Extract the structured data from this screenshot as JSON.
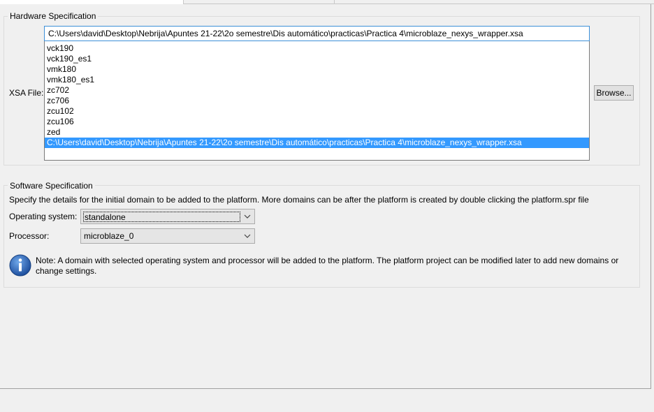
{
  "hardware": {
    "group_title": "Hardware Specification",
    "xsa_label": "XSA File:",
    "xsa_value": "C:\\Users\\david\\Desktop\\Nebrija\\Apuntes 21-22\\2o semestre\\Dis automático\\practicas\\Practica 4\\microblaze_nexys_wrapper.xsa",
    "browse_label": "Browse...",
    "options": [
      "vck190",
      "vck190_es1",
      "vmk180",
      "vmk180_es1",
      "zc702",
      "zc706",
      "zcu102",
      "zcu106",
      "zed",
      "C:\\Users\\david\\Desktop\\Nebrija\\Apuntes 21-22\\2o semestre\\Dis automático\\practicas\\Practica 4\\microblaze_nexys_wrapper.xsa"
    ],
    "selected_index": 9
  },
  "software": {
    "group_title": "Software Specification",
    "description": "Specify the details for the initial domain to be added to the platform. More domains can be after the platform is created by double clicking the platform.spr file",
    "os_label": "Operating system:",
    "os_value": "standalone",
    "processor_label": "Processor:",
    "processor_value": "microblaze_0",
    "note": "Note: A domain with selected operating system and processor will be added to the platform. The platform project can be modified later to add new domains or change settings."
  },
  "colors": {
    "selection": "#3399ff",
    "focus_border": "#3c8fd8",
    "info_icon": "#1e63b8"
  },
  "icons": {
    "info": "info-icon",
    "dropdown": "chevron-down-icon"
  }
}
